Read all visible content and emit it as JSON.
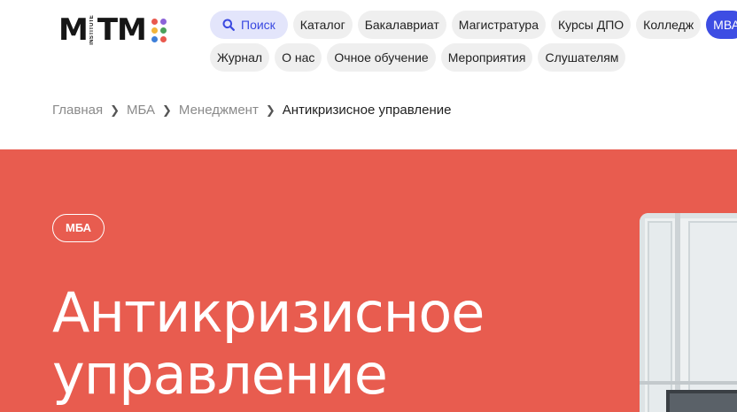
{
  "logo": {
    "letters": [
      "M",
      "T",
      "M"
    ],
    "sub": "INSTITUTE",
    "dot_colors": [
      "#e9584d",
      "#8b63d8",
      "#f2b43a",
      "#4aa05a",
      "#3d7fd9",
      "#e9584d"
    ]
  },
  "nav": {
    "row1": [
      {
        "label": "Поиск",
        "kind": "search"
      },
      {
        "label": "Каталог"
      },
      {
        "label": "Бакалавриат"
      },
      {
        "label": "Магистратура"
      },
      {
        "label": "Курсы ДПО"
      },
      {
        "label": "Колледж"
      },
      {
        "label": "МВА",
        "kind": "active"
      }
    ],
    "row2": [
      {
        "label": "Журнал"
      },
      {
        "label": "О нас"
      },
      {
        "label": "Очное обучение"
      },
      {
        "label": "Мероприятия"
      },
      {
        "label": "Слушателям"
      }
    ]
  },
  "breadcrumb": {
    "items": [
      "Главная",
      "МБА",
      "Менеджмент"
    ],
    "current": "Антикризисное управление"
  },
  "hero": {
    "tag": "МБА",
    "title_line1": "Антикризисное",
    "title_line2": "управление",
    "bg_color": "#e85c4f"
  },
  "colors": {
    "accent": "#3d4de3",
    "search_bg": "#e3e5fb"
  }
}
